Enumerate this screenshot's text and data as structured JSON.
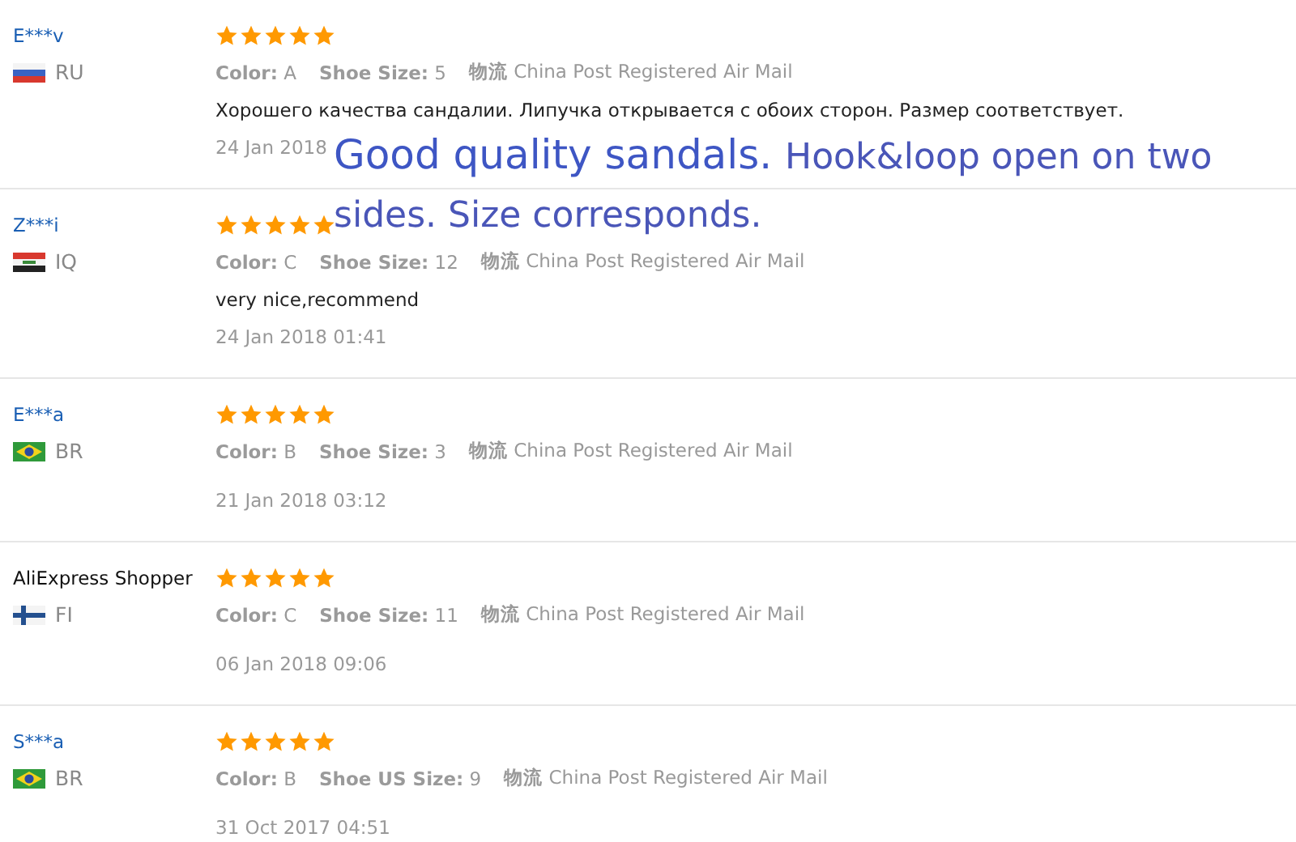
{
  "reviews": [
    {
      "user": "E***v",
      "linked": true,
      "kind": "ru",
      "country": "RU",
      "stars": 5,
      "meta": [
        {
          "label": "Color:",
          "value": "A"
        },
        {
          "label": "Shoe Size:",
          "value": "5"
        },
        {
          "label": "物流",
          "value": "China Post Registered Air Mail"
        }
      ],
      "comment": "Хорошего качества сандалии. Липучка открывается с обоих сторон. Размер соответствует.",
      "date": "24 Jan 2018"
    },
    {
      "user": "Z***i",
      "linked": true,
      "kind": "iq",
      "country": "IQ",
      "stars": 5,
      "meta": [
        {
          "label": "Color:",
          "value": "C"
        },
        {
          "label": "Shoe Size:",
          "value": "12"
        },
        {
          "label": "物流",
          "value": "China Post Registered Air Mail"
        }
      ],
      "comment": "very nice,recommend",
      "date": "24 Jan 2018 01:41"
    },
    {
      "user": "E***a",
      "linked": true,
      "kind": "br",
      "country": "BR",
      "stars": 5,
      "meta": [
        {
          "label": "Color:",
          "value": "B"
        },
        {
          "label": "Shoe Size:",
          "value": "3"
        },
        {
          "label": "物流",
          "value": "China Post Registered Air Mail"
        }
      ],
      "date": "21 Jan 2018 03:12"
    },
    {
      "user": "AliExpress Shopper",
      "linked": false,
      "kind": "fi",
      "country": "FI",
      "stars": 5,
      "meta": [
        {
          "label": "Color:",
          "value": "C"
        },
        {
          "label": "Shoe Size:",
          "value": "11"
        },
        {
          "label": "物流",
          "value": "China Post Registered Air Mail"
        }
      ],
      "date": "06 Jan 2018 09:06"
    },
    {
      "user": "S***a",
      "linked": true,
      "kind": "br",
      "country": "BR",
      "stars": 5,
      "meta": [
        {
          "label": "Color:",
          "value": "B"
        },
        {
          "label": "Shoe US Size:",
          "value": "9"
        },
        {
          "label": "物流",
          "value": "China Post Registered Air Mail"
        }
      ],
      "date": "31 Oct 2017 04:51"
    }
  ],
  "translation": {
    "headline": "Good quality sandals.",
    "rest": "Hook&loop open on two sides. Size corresponds."
  }
}
